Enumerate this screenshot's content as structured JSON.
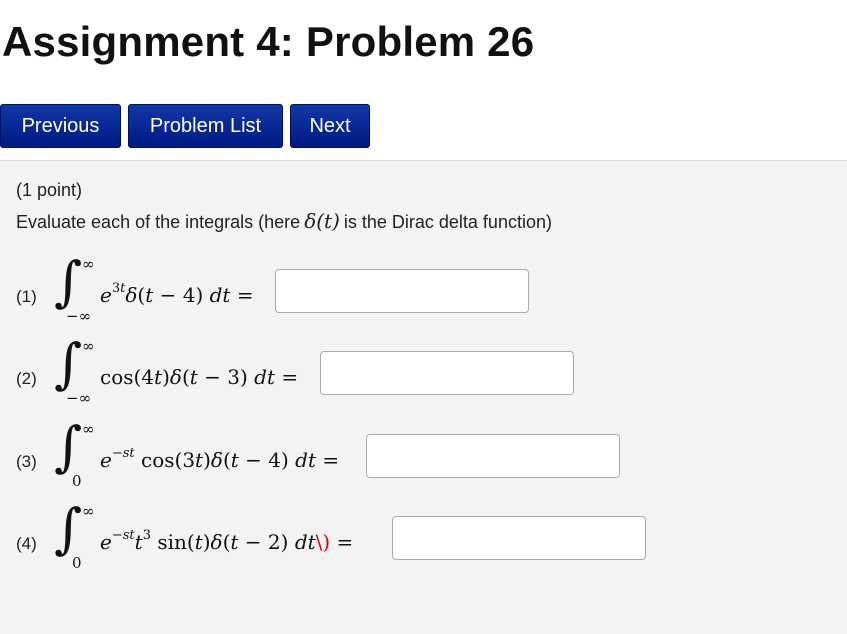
{
  "header": {
    "title": "Assignment 4: Problem 26"
  },
  "nav": {
    "previous_label": "Previous",
    "problem_list_label": "Problem List",
    "next_label": "Next"
  },
  "problem": {
    "points": "(1 point)",
    "statement_prefix": "Evaluate each of the integrals (here",
    "statement_symbol": "δ(t)",
    "statement_suffix": "is the Dirac delta function)",
    "parts": [
      {
        "label": "(1)",
        "upper": "∞",
        "lower": "−∞",
        "answer": ""
      },
      {
        "label": "(2)",
        "upper": "∞",
        "lower": "−∞",
        "answer": ""
      },
      {
        "label": "(3)",
        "upper": "∞",
        "lower": "0",
        "answer": ""
      },
      {
        "label": "(4)",
        "upper": "∞",
        "lower": "0",
        "answer": ""
      }
    ]
  }
}
